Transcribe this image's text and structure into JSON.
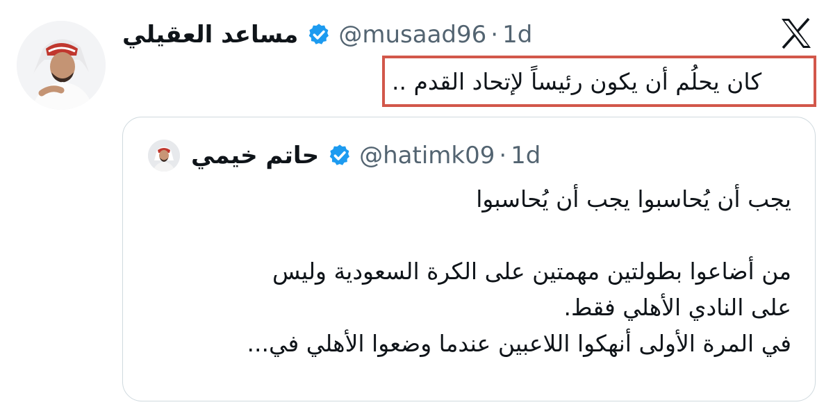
{
  "tweet": {
    "author_name": "مساعد العقيلي",
    "author_handle": "@musaad96",
    "separator": "·",
    "timestamp": "1d",
    "text": "كان يحلُم أن يكون رئيساً لإتحاد القدم ..",
    "highlight_color": "#d2574a"
  },
  "quoted_tweet": {
    "author_name": "حاتم خيمي",
    "author_handle": "@hatimk09",
    "separator": "·",
    "timestamp": "1d",
    "lines": [
      "يجب أن يُحاسبوا يجب أن يُحاسبوا",
      "من أضاعوا بطولتين مهمتين على الكرة السعودية وليس",
      "على النادي  الأهلي فقط.",
      "في المرة الأولى أنهكوا اللاعبين عندما وضعوا الأهلي في..."
    ]
  },
  "icons": {
    "platform_logo": "x-logo-icon",
    "verified": "verified-badge-icon"
  },
  "colors": {
    "verified_blue": "#1d9bf0",
    "secondary_text": "#536471",
    "border": "#cfd9de"
  }
}
